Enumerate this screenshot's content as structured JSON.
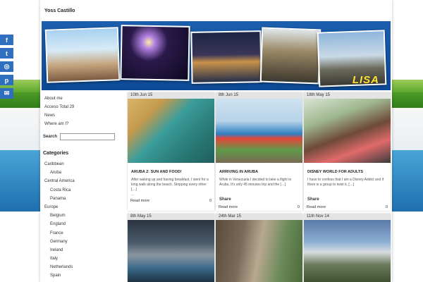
{
  "site": {
    "title": "Yoss Castillo"
  },
  "banner": {
    "tag": "LISA"
  },
  "social": [
    {
      "name": "facebook-icon",
      "glyph": "f"
    },
    {
      "name": "twitter-icon",
      "glyph": "t"
    },
    {
      "name": "instagram-icon",
      "glyph": "◎"
    },
    {
      "name": "pinterest-icon",
      "glyph": "p"
    },
    {
      "name": "email-icon",
      "glyph": "✉"
    }
  ],
  "nav": [
    "About me",
    "Acceso Total 29",
    "News",
    "Where am I?"
  ],
  "search": {
    "label": "Search",
    "value": ""
  },
  "categories": {
    "heading": "Categories",
    "items": [
      {
        "label": "Caribbean",
        "level": 0
      },
      {
        "label": "Aruba",
        "level": 1
      },
      {
        "label": "Central America",
        "level": 0
      },
      {
        "label": "Costa Rica",
        "level": 1
      },
      {
        "label": "Panama",
        "level": 1
      },
      {
        "label": "Europe",
        "level": 0
      },
      {
        "label": "Belgium",
        "level": 1
      },
      {
        "label": "England",
        "level": 1
      },
      {
        "label": "France",
        "level": 1
      },
      {
        "label": "Germany",
        "level": 1
      },
      {
        "label": "Ireland",
        "level": 1
      },
      {
        "label": "Italy",
        "level": 1
      },
      {
        "label": "Netherlands",
        "level": 1
      },
      {
        "label": "Spain",
        "level": 1
      }
    ]
  },
  "posts": [
    {
      "date": "10th Jun 15",
      "title": "Aruba 2: Sun and Food!",
      "excerpt": "After waking up and having breakfast, I went for a long walk along the beach. Stopping every other […]",
      "extra": "...",
      "read_more": "Read more",
      "comments": "0"
    },
    {
      "date": "8th Jun 15",
      "title": "Arriving in Aruba",
      "excerpt": "While in Venezuela I decided to take a flight to Aruba. It's only 45 minutes trip and the […]",
      "share": "Share",
      "read_more": "Read more",
      "comments": "0"
    },
    {
      "date": "18th May 15",
      "title": "Disney World for adults",
      "excerpt": "I have to confess that I am a Disney Addict and if there is a group to twist it, […]",
      "share": "Share",
      "read_more": "Read more",
      "comments": "0"
    },
    {
      "date": "8th May 15"
    },
    {
      "date": "24th Mar 15"
    },
    {
      "date": "11th Nov 14"
    }
  ]
}
